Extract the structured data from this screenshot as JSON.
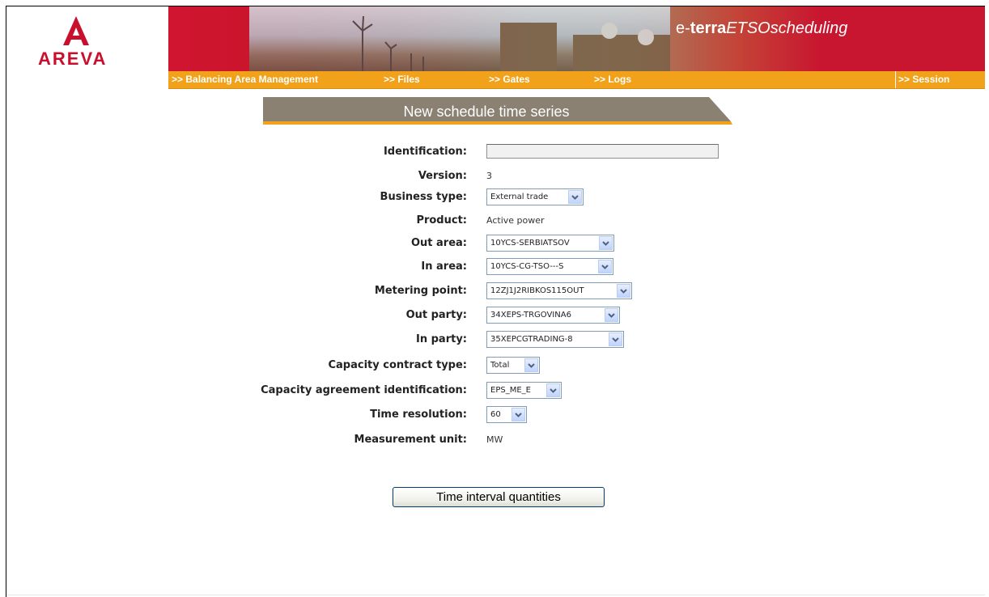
{
  "brand": {
    "company": "AREVA",
    "product_prefix": "e-",
    "product_bold": "terra",
    "product_italic": "ETSOscheduling"
  },
  "nav": {
    "items": [
      {
        "label": ">> Balancing Area Management"
      },
      {
        "label": ">> Files"
      },
      {
        "label": ">> Gates"
      },
      {
        "label": ">> Logs"
      }
    ],
    "session": ">> Session"
  },
  "page": {
    "title": "New schedule time series"
  },
  "form": {
    "identification": {
      "label": "Identification:",
      "value": ""
    },
    "version": {
      "label": "Version:",
      "value": "3"
    },
    "business_type": {
      "label": "Business type:",
      "value": "External trade"
    },
    "product": {
      "label": "Product:",
      "value": "Active power"
    },
    "out_area": {
      "label": "Out area:",
      "value": "10YCS-SERBIATSOV"
    },
    "in_area": {
      "label": "In area:",
      "value": "10YCS-CG-TSO---S"
    },
    "metering_point": {
      "label": "Metering point:",
      "value": "12ZJ1J2RIBKOS115OUT"
    },
    "out_party": {
      "label": "Out party:",
      "value": "34XEPS-TRGOVINA6"
    },
    "in_party": {
      "label": "In party:",
      "value": "35XEPCGTRADING-8"
    },
    "capacity_contract_type": {
      "label": "Capacity contract type:",
      "value": "Total"
    },
    "capacity_agreement_identification": {
      "label": "Capacity agreement identification:",
      "value": "EPS_ME_E"
    },
    "time_resolution": {
      "label": "Time resolution:",
      "value": "60"
    },
    "measurement_unit": {
      "label": "Measurement unit:",
      "value": "MW"
    }
  },
  "actions": {
    "time_interval_quantities": "Time interval quantities"
  },
  "colors": {
    "brand_red": "#c8102e",
    "nav_orange": "#f2a21a",
    "title_bar_gray": "#8a8172",
    "title_bar_accent": "#f2a21a"
  },
  "icons": {
    "logo": "areva-logo-icon",
    "dropdown": "chevron-down-icon"
  }
}
